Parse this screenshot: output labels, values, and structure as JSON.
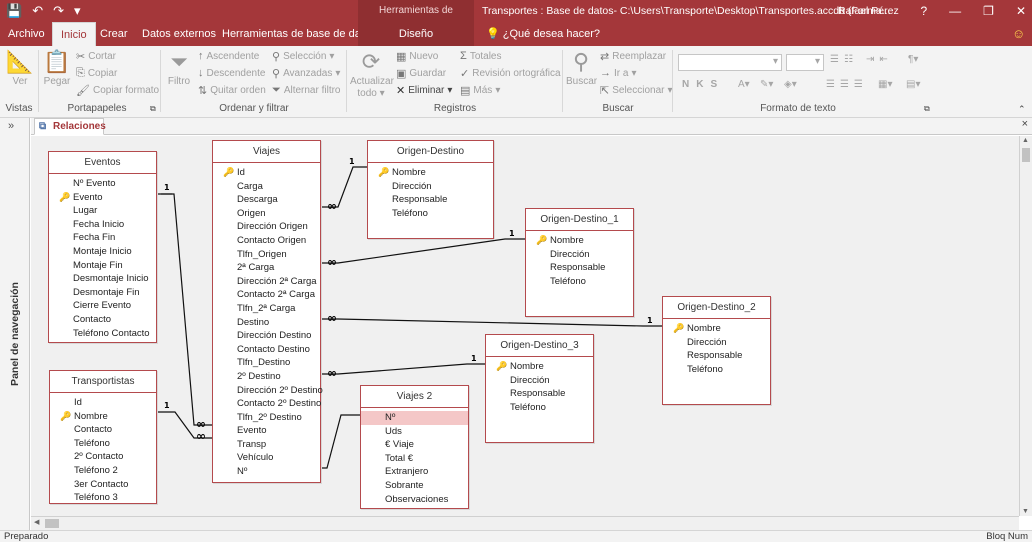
{
  "app": {
    "context_tab_group": "Herramientas de relaciones",
    "document_title": "Transportes : Base de datos- C:\\Users\\Transporte\\Desktop\\Transportes.accdb (Forma...",
    "user": "Rafael Pérez",
    "help": "?"
  },
  "tabs": [
    "Archivo",
    "Inicio",
    "Crear",
    "Datos externos",
    "Herramientas de base de datos",
    "Diseño"
  ],
  "active_tab": "Inicio",
  "search_tell_me": "¿Qué desea hacer?",
  "ribbon": {
    "vistas": {
      "label": "Vistas",
      "ver": "Ver"
    },
    "portapapeles": {
      "label": "Portapapeles",
      "pegar": "Pegar",
      "cortar": "Cortar",
      "copiar": "Copiar",
      "copiar_formato": "Copiar formato"
    },
    "ordenar": {
      "label": "Ordenar y filtrar",
      "filtro": "Filtro",
      "ascendente": "Ascendente",
      "descendente": "Descendente",
      "quitar_orden": "Quitar orden",
      "seleccion": "Selección",
      "avanzadas": "Avanzadas",
      "alternar_filtro": "Alternar filtro"
    },
    "registros": {
      "label": "Registros",
      "actualizar": "Actualizar",
      "todo": "todo",
      "nuevo": "Nuevo",
      "guardar": "Guardar",
      "eliminar": "Eliminar",
      "totales": "Totales",
      "revision": "Revisión ortográfica",
      "mas": "Más"
    },
    "buscar": {
      "label": "Buscar",
      "buscar": "Buscar",
      "reemplazar": "Reemplazar",
      "ir_a": "Ir a",
      "seleccionar": "Seleccionar"
    },
    "formato": {
      "label": "Formato de texto"
    }
  },
  "nav_pane": {
    "label": "Panel de navegación",
    "toggle": "»"
  },
  "document_tab": {
    "label": "Relaciones",
    "close": "×"
  },
  "tables": {
    "eventos": {
      "title": "Eventos",
      "fields": [
        {
          "name": "Nº Evento",
          "key": false
        },
        {
          "name": "Evento",
          "key": true
        },
        {
          "name": "Lugar",
          "key": false
        },
        {
          "name": "Fecha Inicio",
          "key": false
        },
        {
          "name": "Fecha Fin",
          "key": false
        },
        {
          "name": "Montaje Inicio",
          "key": false
        },
        {
          "name": "Montaje Fin",
          "key": false
        },
        {
          "name": "Desmontaje Inicio",
          "key": false
        },
        {
          "name": "Desmontaje Fin",
          "key": false
        },
        {
          "name": "Cierre Evento",
          "key": false
        },
        {
          "name": "Contacto",
          "key": false
        },
        {
          "name": "Teléfono Contacto",
          "key": false
        }
      ]
    },
    "transportistas": {
      "title": "Transportistas",
      "fields": [
        {
          "name": "Id",
          "key": false
        },
        {
          "name": "Nombre",
          "key": true
        },
        {
          "name": "Contacto",
          "key": false
        },
        {
          "name": "Teléfono",
          "key": false
        },
        {
          "name": "2º Contacto",
          "key": false
        },
        {
          "name": "Teléfono 2",
          "key": false
        },
        {
          "name": "3er Contacto",
          "key": false
        },
        {
          "name": "Teléfono 3",
          "key": false
        }
      ]
    },
    "viajes": {
      "title": "Viajes",
      "fields": [
        {
          "name": "Id",
          "key": true
        },
        {
          "name": "Carga",
          "key": false
        },
        {
          "name": "Descarga",
          "key": false
        },
        {
          "name": "Origen",
          "key": false
        },
        {
          "name": "Dirección Origen",
          "key": false
        },
        {
          "name": "Contacto Origen",
          "key": false
        },
        {
          "name": "Tlfn_Origen",
          "key": false
        },
        {
          "name": "2ª Carga",
          "key": false
        },
        {
          "name": "Dirección 2ª Carga",
          "key": false
        },
        {
          "name": "Contacto 2ª Carga",
          "key": false
        },
        {
          "name": "Tlfn_2ª Carga",
          "key": false
        },
        {
          "name": "Destino",
          "key": false
        },
        {
          "name": "Dirección Destino",
          "key": false
        },
        {
          "name": "Contacto Destino",
          "key": false
        },
        {
          "name": "Tlfn_Destino",
          "key": false
        },
        {
          "name": "2º Destino",
          "key": false
        },
        {
          "name": "Dirección 2º Destino",
          "key": false
        },
        {
          "name": "Contacto 2º Destino",
          "key": false
        },
        {
          "name": "Tlfn_2º Destino",
          "key": false
        },
        {
          "name": "Evento",
          "key": false
        },
        {
          "name": "Transp",
          "key": false
        },
        {
          "name": "Vehículo",
          "key": false
        },
        {
          "name": "Nº",
          "key": false
        }
      ]
    },
    "viajes2": {
      "title": "Viajes 2",
      "fields": [
        {
          "name": "Nº",
          "key": false,
          "selected": true
        },
        {
          "name": "Uds",
          "key": false
        },
        {
          "name": "€ Viaje",
          "key": false
        },
        {
          "name": "Total €",
          "key": false
        },
        {
          "name": "Extranjero",
          "key": false
        },
        {
          "name": "Sobrante",
          "key": false
        },
        {
          "name": "Observaciones",
          "key": false
        }
      ]
    },
    "od": {
      "title": "Origen-Destino",
      "fields": [
        {
          "name": "Nombre",
          "key": true
        },
        {
          "name": "Dirección",
          "key": false
        },
        {
          "name": "Responsable",
          "key": false
        },
        {
          "name": "Teléfono",
          "key": false
        }
      ]
    },
    "od1": {
      "title": "Origen-Destino_1",
      "fields": [
        {
          "name": "Nombre",
          "key": true
        },
        {
          "name": "Dirección",
          "key": false
        },
        {
          "name": "Responsable",
          "key": false
        },
        {
          "name": "Teléfono",
          "key": false
        }
      ]
    },
    "od2": {
      "title": "Origen-Destino_2",
      "fields": [
        {
          "name": "Nombre",
          "key": true
        },
        {
          "name": "Dirección",
          "key": false
        },
        {
          "name": "Responsable",
          "key": false
        },
        {
          "name": "Teléfono",
          "key": false
        }
      ]
    },
    "od3": {
      "title": "Origen-Destino_3",
      "fields": [
        {
          "name": "Nombre",
          "key": true
        },
        {
          "name": "Dirección",
          "key": false
        },
        {
          "name": "Responsable",
          "key": false
        },
        {
          "name": "Teléfono",
          "key": false
        }
      ]
    }
  },
  "relationships": [
    {
      "from": "Eventos.Evento",
      "to": "Viajes.Evento",
      "one": "1",
      "many": "∞"
    },
    {
      "from": "Transportistas.Nombre",
      "to": "Viajes.Transp",
      "one": "1",
      "many": "∞"
    },
    {
      "from": "Origen-Destino.Nombre",
      "to": "Viajes.Origen",
      "one": "1",
      "many": "∞"
    },
    {
      "from": "Origen-Destino_1.Nombre",
      "to": "Viajes.2ª Carga",
      "one": "1",
      "many": "∞"
    },
    {
      "from": "Origen-Destino_2.Nombre",
      "to": "Viajes.Destino",
      "one": "1",
      "many": "∞"
    },
    {
      "from": "Origen-Destino_3.Nombre",
      "to": "Viajes.2º Destino",
      "one": "1",
      "many": "∞"
    },
    {
      "from": "Viajes.Nº",
      "to": "Viajes 2.Nº"
    }
  ],
  "status": {
    "left": "Preparado",
    "right": "Bloq Num"
  },
  "colors": {
    "accent": "#a4373a",
    "table_border": "#b44a4d",
    "selected_field": "#f4c7c7"
  }
}
